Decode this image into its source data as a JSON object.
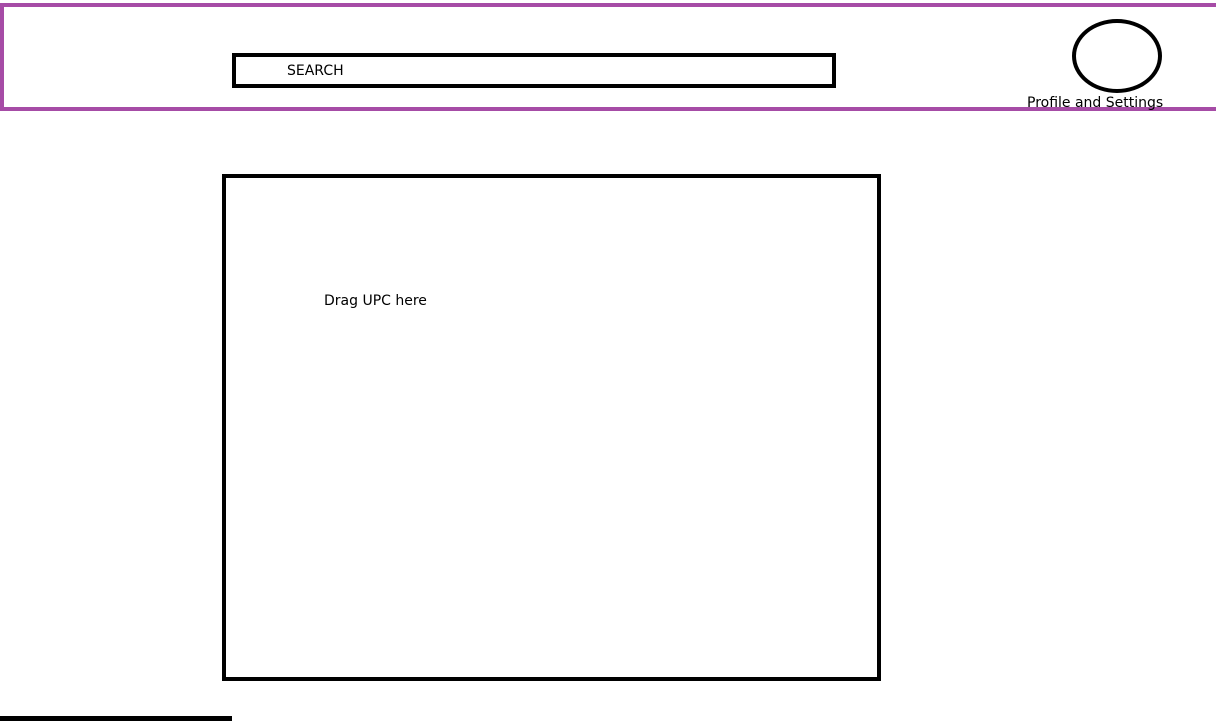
{
  "header": {
    "search": {
      "label": "SEARCH"
    },
    "profile": {
      "label": "Profile and Settings"
    }
  },
  "main": {
    "drop_zone": {
      "label": "Drag UPC here"
    }
  },
  "colors": {
    "header_border": "#a64ca6",
    "outline": "#000000",
    "background": "#ffffff"
  }
}
